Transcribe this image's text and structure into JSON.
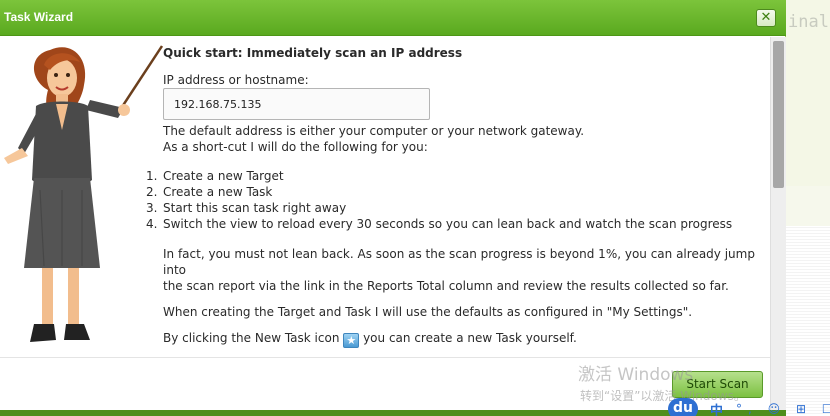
{
  "dialog": {
    "title": "Task Wizard",
    "close_glyph": "✕"
  },
  "background_app": {
    "text": "inal"
  },
  "main": {
    "heading": "Quick start: Immediately scan an IP address",
    "address_label": "IP address or hostname:",
    "address_value": "192.168.75.135",
    "intro_line1": "The default address is either your computer or your network gateway.",
    "intro_line2": "As a short-cut I will do the following for you:",
    "steps": [
      {
        "num": "1.",
        "text": "Create a new Target"
      },
      {
        "num": "2.",
        "text": "Create a new Task"
      },
      {
        "num": "3.",
        "text": "Start this scan task right away"
      },
      {
        "num": "4.",
        "text": "Switch the view to reload every 30 seconds so you can lean back and watch the scan progress"
      }
    ],
    "para1_line1": "In fact, you must not lean back. As soon as the scan progress is beyond 1%, you can already jump into",
    "para1_line2": "the scan report via the link in the Reports Total column and review the results collected so far.",
    "para2": "When creating the Target and Task I will use the defaults as configured in \"My Settings\".",
    "para3_before": "By clicking the New Task icon",
    "para3_after": "you can create a new Task yourself.",
    "new_task_icon": "star-icon"
  },
  "footer": {
    "start_scan_label": "Start Scan"
  },
  "watermark": {
    "line1": "激活 Windows",
    "line2": "转到“设置”以激活 Windows。"
  },
  "ime": {
    "logo": "du",
    "lang": "中",
    "icons": "°, ☺ ⊞ ☐ 品"
  },
  "colors": {
    "titlebar": "#6cb82f",
    "button": "#8dcb52",
    "text": "#2a2a2a"
  }
}
